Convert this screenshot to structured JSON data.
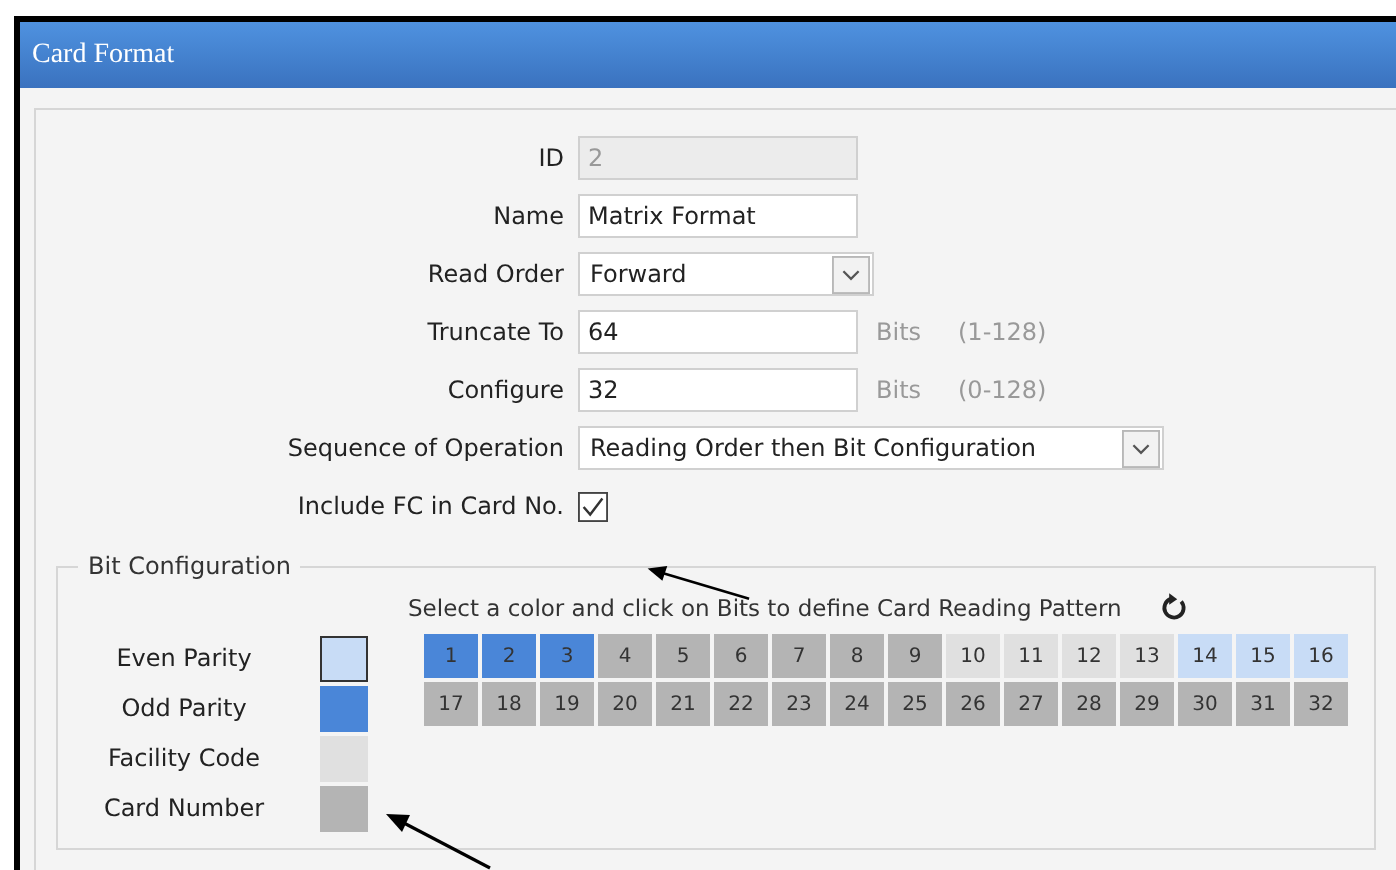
{
  "window": {
    "title": "Card Format"
  },
  "form": [
    {
      "kind": "text",
      "label": "ID",
      "value": "2",
      "disabled": true
    },
    {
      "kind": "text",
      "label": "Name",
      "value": "Matrix Format",
      "disabled": false
    },
    {
      "kind": "dropdown",
      "label": "Read Order",
      "value": "Forward",
      "wide": false
    },
    {
      "kind": "text",
      "label": "Truncate To",
      "value": "64",
      "disabled": false,
      "unit": "Bits",
      "range": "(1-128)"
    },
    {
      "kind": "text",
      "label": "Configure",
      "value": "32",
      "disabled": false,
      "unit": "Bits",
      "range": "(0-128)"
    },
    {
      "kind": "dropdown",
      "label": "Sequence of Operation",
      "value": "Reading Order then Bit Configuration",
      "wide": true
    },
    {
      "kind": "checkbox",
      "label": "Include FC in Card No.",
      "checked": true
    }
  ],
  "bit_configuration": {
    "title": "Bit Configuration",
    "instruction": "Select a color and click on Bits to define Card Reading Pattern",
    "legend": [
      {
        "label": "Even Parity",
        "color": "#c8dcf6",
        "selected": true
      },
      {
        "label": "Odd Parity",
        "color": "#4a86d8",
        "selected": false
      },
      {
        "label": "Facility Code",
        "color": "#e0e0e0",
        "selected": false
      },
      {
        "label": "Card Number",
        "color": "#b4b4b4",
        "selected": false
      }
    ],
    "bits": [
      {
        "label": "1",
        "color": "#4a86d8"
      },
      {
        "label": "2",
        "color": "#4a86d8"
      },
      {
        "label": "3",
        "color": "#4a86d8"
      },
      {
        "label": "4",
        "color": "#b4b4b4"
      },
      {
        "label": "5",
        "color": "#b4b4b4"
      },
      {
        "label": "6",
        "color": "#b4b4b4"
      },
      {
        "label": "7",
        "color": "#b4b4b4"
      },
      {
        "label": "8",
        "color": "#b4b4b4"
      },
      {
        "label": "9",
        "color": "#b4b4b4"
      },
      {
        "label": "10",
        "color": "#e0e0e0"
      },
      {
        "label": "11",
        "color": "#e0e0e0"
      },
      {
        "label": "12",
        "color": "#e0e0e0"
      },
      {
        "label": "13",
        "color": "#e0e0e0"
      },
      {
        "label": "14",
        "color": "#c8dcf6"
      },
      {
        "label": "15",
        "color": "#c8dcf6"
      },
      {
        "label": "16",
        "color": "#c8dcf6"
      },
      {
        "label": "17",
        "color": "#b4b4b4"
      },
      {
        "label": "18",
        "color": "#b4b4b4"
      },
      {
        "label": "19",
        "color": "#b4b4b4"
      },
      {
        "label": "20",
        "color": "#b4b4b4"
      },
      {
        "label": "21",
        "color": "#b4b4b4"
      },
      {
        "label": "22",
        "color": "#b4b4b4"
      },
      {
        "label": "23",
        "color": "#b4b4b4"
      },
      {
        "label": "24",
        "color": "#b4b4b4"
      },
      {
        "label": "25",
        "color": "#b4b4b4"
      },
      {
        "label": "26",
        "color": "#b4b4b4"
      },
      {
        "label": "27",
        "color": "#b4b4b4"
      },
      {
        "label": "28",
        "color": "#b4b4b4"
      },
      {
        "label": "29",
        "color": "#b4b4b4"
      },
      {
        "label": "30",
        "color": "#b4b4b4"
      },
      {
        "label": "31",
        "color": "#b4b4b4"
      },
      {
        "label": "32",
        "color": "#b4b4b4"
      }
    ]
  }
}
